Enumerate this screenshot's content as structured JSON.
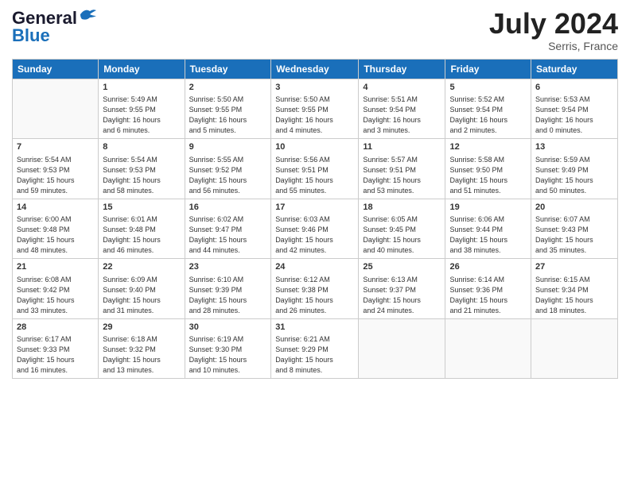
{
  "header": {
    "logo_general": "General",
    "logo_blue": "Blue",
    "month_title": "July 2024",
    "location": "Serris, France"
  },
  "days_of_week": [
    "Sunday",
    "Monday",
    "Tuesday",
    "Wednesday",
    "Thursday",
    "Friday",
    "Saturday"
  ],
  "weeks": [
    [
      {
        "day": "",
        "info": ""
      },
      {
        "day": "1",
        "info": "Sunrise: 5:49 AM\nSunset: 9:55 PM\nDaylight: 16 hours\nand 6 minutes."
      },
      {
        "day": "2",
        "info": "Sunrise: 5:50 AM\nSunset: 9:55 PM\nDaylight: 16 hours\nand 5 minutes."
      },
      {
        "day": "3",
        "info": "Sunrise: 5:50 AM\nSunset: 9:55 PM\nDaylight: 16 hours\nand 4 minutes."
      },
      {
        "day": "4",
        "info": "Sunrise: 5:51 AM\nSunset: 9:54 PM\nDaylight: 16 hours\nand 3 minutes."
      },
      {
        "day": "5",
        "info": "Sunrise: 5:52 AM\nSunset: 9:54 PM\nDaylight: 16 hours\nand 2 minutes."
      },
      {
        "day": "6",
        "info": "Sunrise: 5:53 AM\nSunset: 9:54 PM\nDaylight: 16 hours\nand 0 minutes."
      }
    ],
    [
      {
        "day": "7",
        "info": "Sunrise: 5:54 AM\nSunset: 9:53 PM\nDaylight: 15 hours\nand 59 minutes."
      },
      {
        "day": "8",
        "info": "Sunrise: 5:54 AM\nSunset: 9:53 PM\nDaylight: 15 hours\nand 58 minutes."
      },
      {
        "day": "9",
        "info": "Sunrise: 5:55 AM\nSunset: 9:52 PM\nDaylight: 15 hours\nand 56 minutes."
      },
      {
        "day": "10",
        "info": "Sunrise: 5:56 AM\nSunset: 9:51 PM\nDaylight: 15 hours\nand 55 minutes."
      },
      {
        "day": "11",
        "info": "Sunrise: 5:57 AM\nSunset: 9:51 PM\nDaylight: 15 hours\nand 53 minutes."
      },
      {
        "day": "12",
        "info": "Sunrise: 5:58 AM\nSunset: 9:50 PM\nDaylight: 15 hours\nand 51 minutes."
      },
      {
        "day": "13",
        "info": "Sunrise: 5:59 AM\nSunset: 9:49 PM\nDaylight: 15 hours\nand 50 minutes."
      }
    ],
    [
      {
        "day": "14",
        "info": "Sunrise: 6:00 AM\nSunset: 9:48 PM\nDaylight: 15 hours\nand 48 minutes."
      },
      {
        "day": "15",
        "info": "Sunrise: 6:01 AM\nSunset: 9:48 PM\nDaylight: 15 hours\nand 46 minutes."
      },
      {
        "day": "16",
        "info": "Sunrise: 6:02 AM\nSunset: 9:47 PM\nDaylight: 15 hours\nand 44 minutes."
      },
      {
        "day": "17",
        "info": "Sunrise: 6:03 AM\nSunset: 9:46 PM\nDaylight: 15 hours\nand 42 minutes."
      },
      {
        "day": "18",
        "info": "Sunrise: 6:05 AM\nSunset: 9:45 PM\nDaylight: 15 hours\nand 40 minutes."
      },
      {
        "day": "19",
        "info": "Sunrise: 6:06 AM\nSunset: 9:44 PM\nDaylight: 15 hours\nand 38 minutes."
      },
      {
        "day": "20",
        "info": "Sunrise: 6:07 AM\nSunset: 9:43 PM\nDaylight: 15 hours\nand 35 minutes."
      }
    ],
    [
      {
        "day": "21",
        "info": "Sunrise: 6:08 AM\nSunset: 9:42 PM\nDaylight: 15 hours\nand 33 minutes."
      },
      {
        "day": "22",
        "info": "Sunrise: 6:09 AM\nSunset: 9:40 PM\nDaylight: 15 hours\nand 31 minutes."
      },
      {
        "day": "23",
        "info": "Sunrise: 6:10 AM\nSunset: 9:39 PM\nDaylight: 15 hours\nand 28 minutes."
      },
      {
        "day": "24",
        "info": "Sunrise: 6:12 AM\nSunset: 9:38 PM\nDaylight: 15 hours\nand 26 minutes."
      },
      {
        "day": "25",
        "info": "Sunrise: 6:13 AM\nSunset: 9:37 PM\nDaylight: 15 hours\nand 24 minutes."
      },
      {
        "day": "26",
        "info": "Sunrise: 6:14 AM\nSunset: 9:36 PM\nDaylight: 15 hours\nand 21 minutes."
      },
      {
        "day": "27",
        "info": "Sunrise: 6:15 AM\nSunset: 9:34 PM\nDaylight: 15 hours\nand 18 minutes."
      }
    ],
    [
      {
        "day": "28",
        "info": "Sunrise: 6:17 AM\nSunset: 9:33 PM\nDaylight: 15 hours\nand 16 minutes."
      },
      {
        "day": "29",
        "info": "Sunrise: 6:18 AM\nSunset: 9:32 PM\nDaylight: 15 hours\nand 13 minutes."
      },
      {
        "day": "30",
        "info": "Sunrise: 6:19 AM\nSunset: 9:30 PM\nDaylight: 15 hours\nand 10 minutes."
      },
      {
        "day": "31",
        "info": "Sunrise: 6:21 AM\nSunset: 9:29 PM\nDaylight: 15 hours\nand 8 minutes."
      },
      {
        "day": "",
        "info": ""
      },
      {
        "day": "",
        "info": ""
      },
      {
        "day": "",
        "info": ""
      }
    ]
  ]
}
